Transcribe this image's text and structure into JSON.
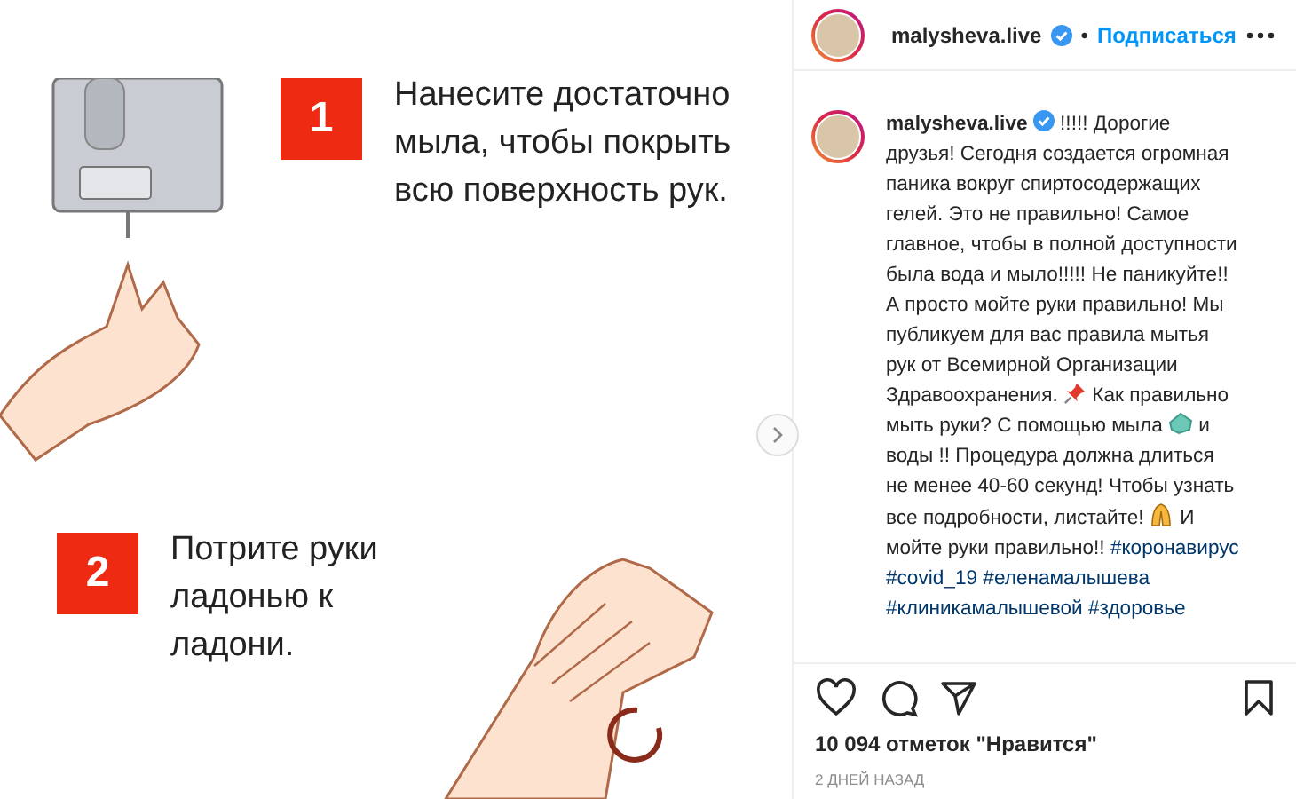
{
  "post_image": {
    "steps": [
      {
        "number": "1",
        "lines": [
          "Нанесите достаточно",
          "мыла, чтобы покрыть",
          "всю поверхность рук."
        ]
      },
      {
        "number": "2",
        "lines": [
          "Потрите руки",
          "ладонью к",
          "ладони."
        ]
      }
    ]
  },
  "header": {
    "username": "malysheva.live",
    "verified": true,
    "separator": "•",
    "follow": "Подписаться"
  },
  "caption": {
    "username": "malysheva.live",
    "verified": true,
    "parts": [
      {
        "kind": "text",
        "text": "!!!!! Дорогие друзья! Сегодня создается огромная паника вокруг спиртосодержащих гелей. Это не правильно! Самое главное, чтобы в полной доступности была вода и мыло!!!!! Не паникуйте!! А просто мойте руки правильно! Мы публикуем для вас правила мытья рук от Всемирной Организации Здравоохранения."
      },
      {
        "kind": "pin"
      },
      {
        "kind": "text",
        "text": "Как правильно мыть руки? С помощью мыла"
      },
      {
        "kind": "soap"
      },
      {
        "kind": "text",
        "text": "и воды !! Процедура должна длиться не менее 40-60 секунд! Чтобы узнать все подробности, листайте!"
      },
      {
        "kind": "hands"
      },
      {
        "kind": "text",
        "text": "И мойте руки правильно!!"
      },
      {
        "kind": "hashtag",
        "text": "#коронавирус"
      },
      {
        "kind": "hashtag",
        "text": "#covid_19"
      },
      {
        "kind": "hashtag",
        "text": "#еленамалышева"
      },
      {
        "kind": "hashtag",
        "text": "#клиникамалышевой"
      },
      {
        "kind": "hashtag",
        "text": "#здоровье"
      }
    ]
  },
  "likes": "10 094 отметок \"Нравится\"",
  "time": "2 ДНЕЙ НАЗАД"
}
